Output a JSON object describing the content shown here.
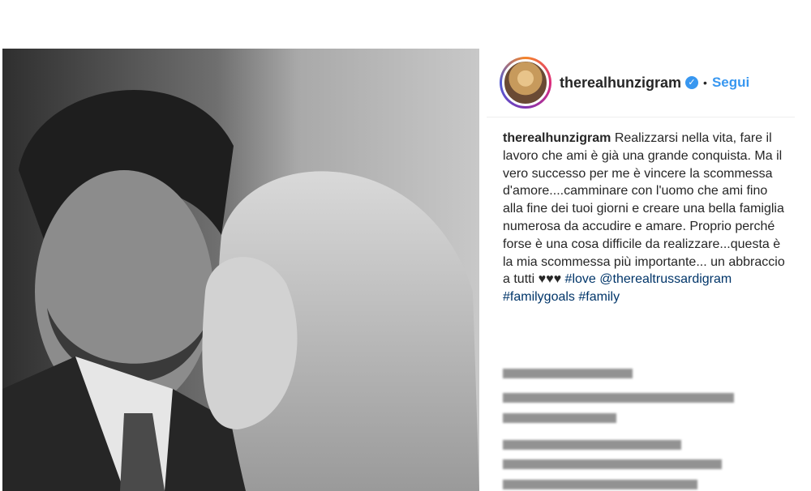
{
  "post": {
    "username": "therealhunzigram",
    "verified_icon": "verified-badge-icon",
    "separator": "•",
    "follow_label": "Segui",
    "caption": {
      "author": "therealhunzigram",
      "text": "Realizzarsi nella vita, fare il lavoro che ami è già una grande conquista. Ma il vero successo per me è vincere la scommessa d'amore....camminare con l'uomo che ami fino alla fine dei tuoi giorni e creare una bella famiglia numerosa da accudire e amare. Proprio perché forse è una cosa difficile da realizzare...questa è la mia scommessa più importante... un abbraccio a tutti",
      "hearts": "♥♥♥",
      "hashtag_love": "#love",
      "mention": "@therealtrussardigram",
      "hashtag_familygoals": "#familygoals",
      "hashtag_family": "#family"
    }
  }
}
